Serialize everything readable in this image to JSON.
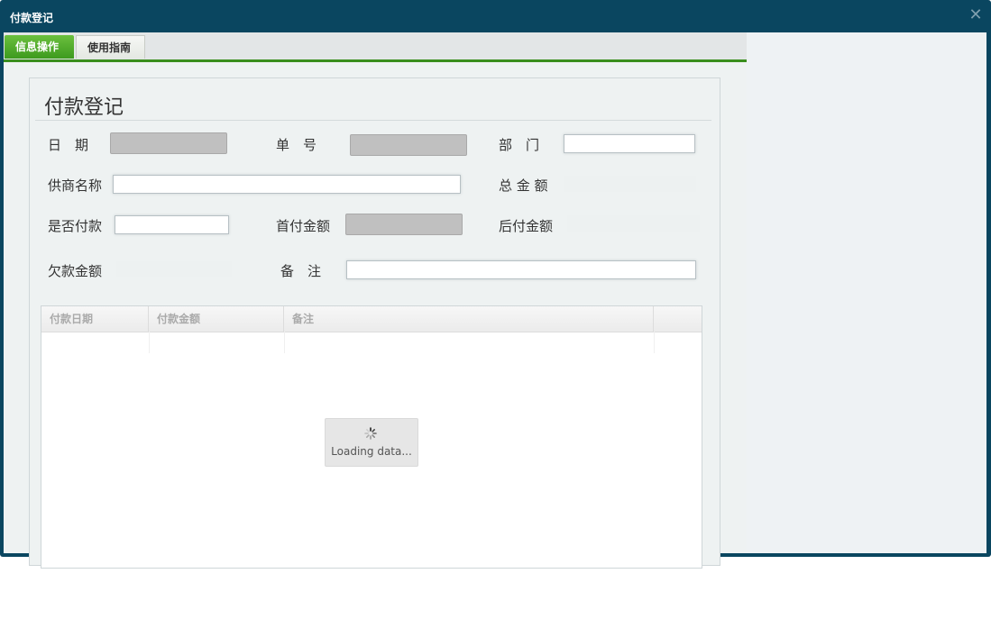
{
  "window": {
    "title": "付款登记",
    "close_icon": "✕"
  },
  "tabs": [
    {
      "label": "信息操作"
    },
    {
      "label": "使用指南"
    }
  ],
  "form": {
    "title": "付款登记",
    "labels": {
      "date": "日　期",
      "order_no": "单　号",
      "department": "部　门",
      "supplier_name": "供商名称",
      "total_amount": "总 金 额",
      "is_paid": "是否付款",
      "first_payment": "首付金额",
      "later_payment": "后付金额",
      "debt_amount": "欠款金额",
      "remark": "备　注"
    },
    "values": {
      "date": "",
      "order_no": "",
      "department": "",
      "supplier_name": "",
      "total_amount": "",
      "is_paid": "",
      "first_payment": "",
      "later_payment": "",
      "debt_amount": "",
      "remark": ""
    }
  },
  "grid": {
    "columns": [
      "付款日期",
      "付款金额",
      "备注"
    ],
    "loading_text": "Loading data..."
  },
  "colors": {
    "titlebar": "#0a4660",
    "tab_active": "#3d9a1e"
  }
}
